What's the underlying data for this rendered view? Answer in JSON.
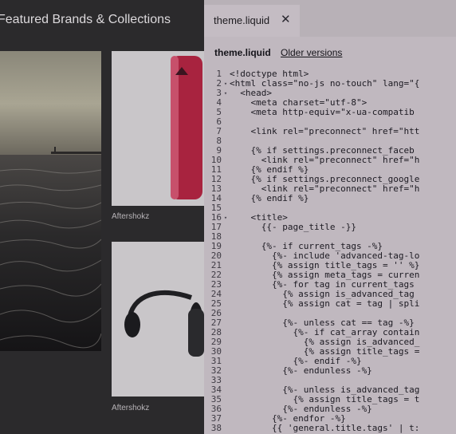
{
  "storefront": {
    "section_heading": "Featured Brands & Collections",
    "products": [
      {
        "caption": "Aftershokz"
      },
      {
        "caption": "Aftershokz"
      }
    ]
  },
  "editor": {
    "tab_label": "theme.liquid",
    "file_title": "theme.liquid",
    "older_versions": "Older versions",
    "lines": [
      {
        "n": "1",
        "fold": "",
        "code": "<!doctype html>"
      },
      {
        "n": "2",
        "fold": "▾",
        "code": "<html class=\"no-js no-touch\" lang=\"{"
      },
      {
        "n": "3",
        "fold": "▾",
        "code": "  <head>"
      },
      {
        "n": "4",
        "fold": "",
        "code": "    <meta charset=\"utf-8\">"
      },
      {
        "n": "5",
        "fold": "",
        "code": "    <meta http-equiv=\"x-ua-compatib"
      },
      {
        "n": "6",
        "fold": "",
        "code": ""
      },
      {
        "n": "7",
        "fold": "",
        "code": "    <link rel=\"preconnect\" href=\"htt"
      },
      {
        "n": "8",
        "fold": "",
        "code": ""
      },
      {
        "n": "9",
        "fold": "",
        "code": "    {% if settings.preconnect_faceb"
      },
      {
        "n": "10",
        "fold": "",
        "code": "      <link rel=\"preconnect\" href=\"h"
      },
      {
        "n": "11",
        "fold": "",
        "code": "    {% endif %}"
      },
      {
        "n": "12",
        "fold": "",
        "code": "    {% if settings.preconnect_google"
      },
      {
        "n": "13",
        "fold": "",
        "code": "      <link rel=\"preconnect\" href=\"h"
      },
      {
        "n": "14",
        "fold": "",
        "code": "    {% endif %}"
      },
      {
        "n": "15",
        "fold": "",
        "code": ""
      },
      {
        "n": "16",
        "fold": "▾",
        "code": "    <title>"
      },
      {
        "n": "17",
        "fold": "",
        "code": "      {{- page_title -}}"
      },
      {
        "n": "18",
        "fold": "",
        "code": ""
      },
      {
        "n": "19",
        "fold": "",
        "code": "      {%- if current_tags -%}"
      },
      {
        "n": "20",
        "fold": "",
        "code": "        {%- include 'advanced-tag-lo"
      },
      {
        "n": "21",
        "fold": "",
        "code": "        {% assign title_tags = '' %}"
      },
      {
        "n": "22",
        "fold": "",
        "code": "        {% assign meta_tags = curren"
      },
      {
        "n": "23",
        "fold": "",
        "code": "        {%- for tag in current_tags"
      },
      {
        "n": "24",
        "fold": "",
        "code": "          {% assign is_advanced_tag"
      },
      {
        "n": "25",
        "fold": "",
        "code": "          {% assign cat = tag | spli"
      },
      {
        "n": "26",
        "fold": "",
        "code": ""
      },
      {
        "n": "27",
        "fold": "",
        "code": "          {%- unless cat == tag -%}"
      },
      {
        "n": "28",
        "fold": "",
        "code": "            {%- if cat_array contain"
      },
      {
        "n": "29",
        "fold": "",
        "code": "              {% assign is_advanced_"
      },
      {
        "n": "30",
        "fold": "",
        "code": "              {% assign title_tags ="
      },
      {
        "n": "31",
        "fold": "",
        "code": "            {%- endif -%}"
      },
      {
        "n": "32",
        "fold": "",
        "code": "          {%- endunless -%}"
      },
      {
        "n": "33",
        "fold": "",
        "code": ""
      },
      {
        "n": "34",
        "fold": "",
        "code": "          {%- unless is_advanced_tag"
      },
      {
        "n": "35",
        "fold": "",
        "code": "            {% assign title_tags = t"
      },
      {
        "n": "36",
        "fold": "",
        "code": "          {%- endunless -%}"
      },
      {
        "n": "37",
        "fold": "",
        "code": "        {%- endfor -%}"
      },
      {
        "n": "38",
        "fold": "",
        "code": "        {{ 'general.title.tags' | t:"
      }
    ]
  }
}
